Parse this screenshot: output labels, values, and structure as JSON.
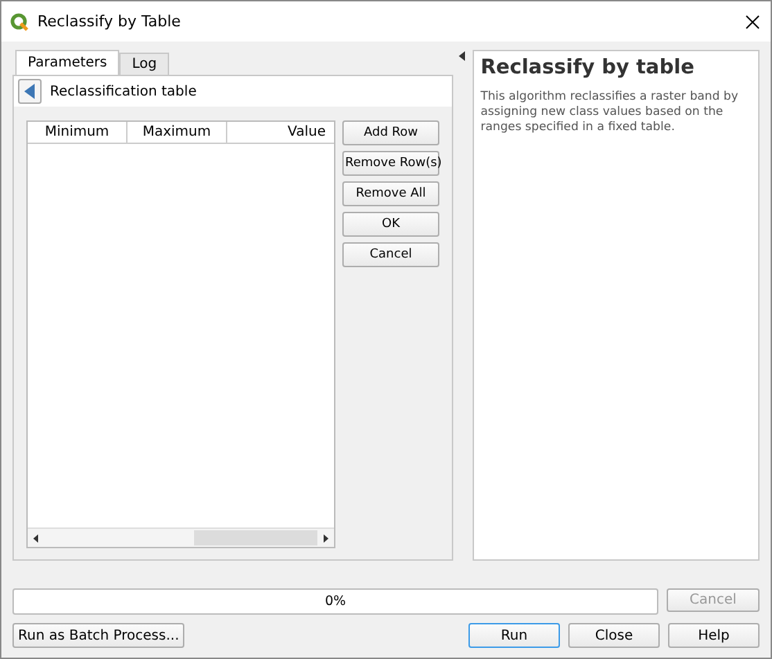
{
  "window": {
    "title": "Reclassify by Table"
  },
  "tabs": [
    {
      "label": "Parameters",
      "selected": true
    },
    {
      "label": "Log",
      "selected": false
    }
  ],
  "panel_header": "Reclassification table",
  "table": {
    "columns": [
      "Minimum",
      "Maximum",
      "Value"
    ]
  },
  "table_buttons": [
    "Add Row",
    "Remove Row(s)",
    "Remove All",
    "OK",
    "Cancel"
  ],
  "help": {
    "title": "Reclassify by table",
    "text": "This algorithm reclassifies a raster band by assigning new class values based on the ranges specified in a fixed table."
  },
  "progress": {
    "text": "0%",
    "level": 0
  },
  "cancel_button": {
    "label": "Cancel",
    "disabled": true
  },
  "batch_button": "Run as Batch Process...",
  "buttons": [
    {
      "label": "Run",
      "default": true
    },
    {
      "label": "Close",
      "default": false
    },
    {
      "label": "Help",
      "default": false
    }
  ]
}
